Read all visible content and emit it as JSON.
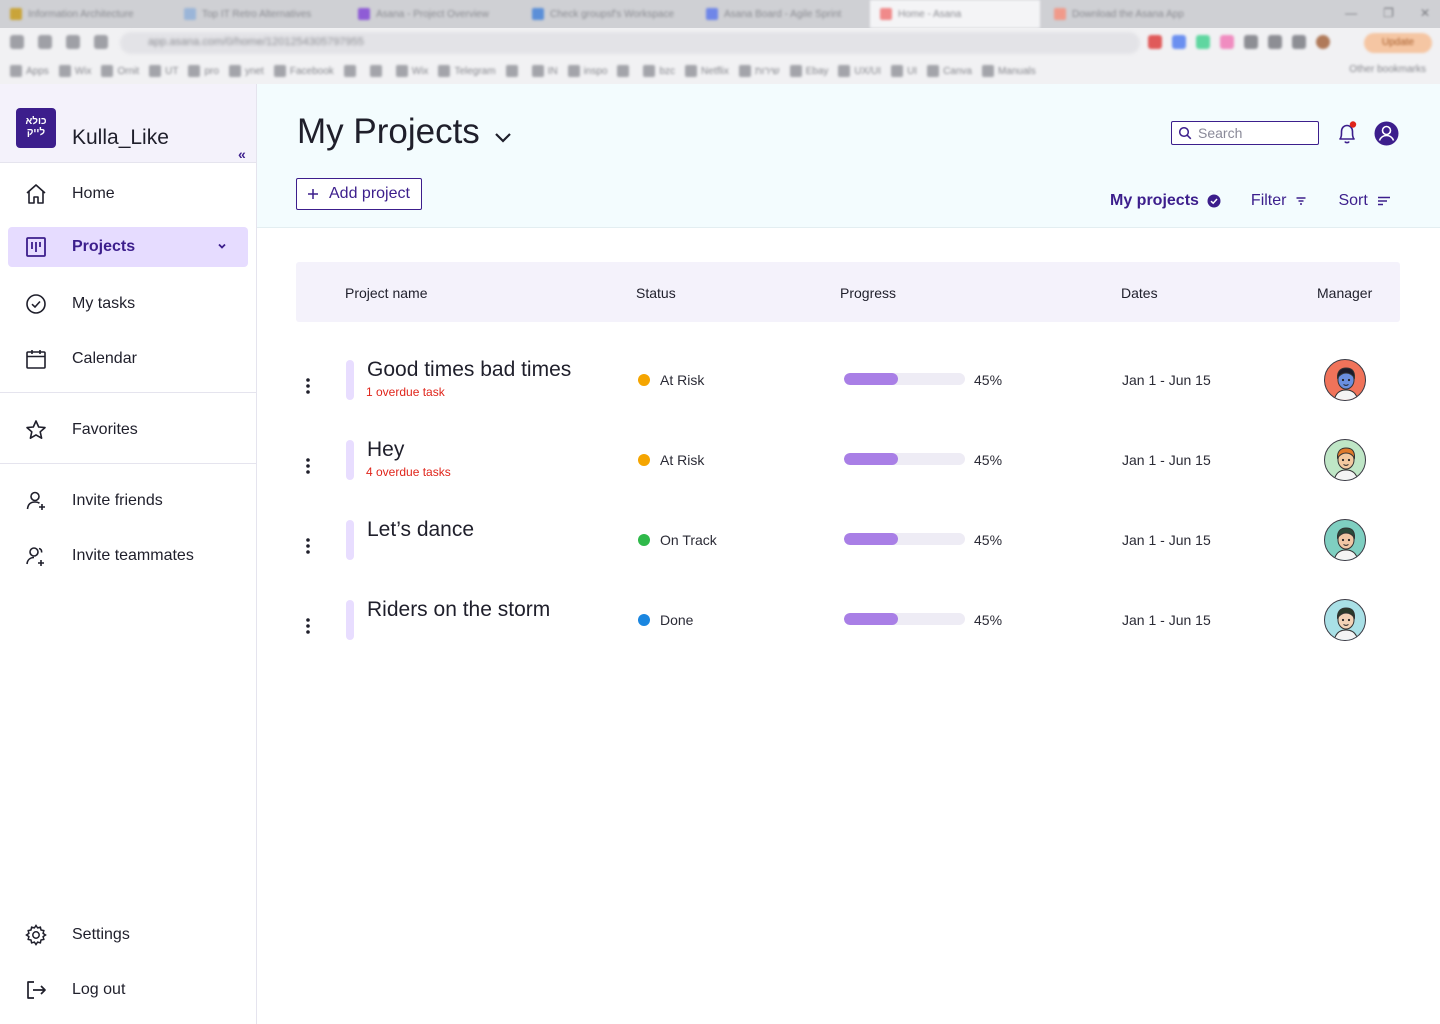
{
  "browser": {
    "tabs": [
      {
        "label": "Information Architecture",
        "favicon_color": "#c9a43a"
      },
      {
        "label": "Top IT Retro Alternatives",
        "favicon_color": "#9bb5d8"
      },
      {
        "label": "Asana - Project Overview",
        "favicon_color": "#8f5cd6"
      },
      {
        "label": "Check groupsf's Workspace",
        "favicon_color": "#5b8fd8"
      },
      {
        "label": "Asana Board - Agile Sprint",
        "favicon_color": "#6f86e8"
      },
      {
        "label": "Home - Asana",
        "favicon_color": "#f08a8a",
        "active": true
      },
      {
        "label": "Download the Asana App",
        "favicon_color": "#f09a8a"
      }
    ],
    "url": "app.asana.com/0/home/1201254305797955",
    "update_label": "Update",
    "bookmarks": [
      "Apps",
      "Wix",
      "Ornit",
      "UT",
      "pro",
      "ynet",
      "Facebook",
      "",
      "",
      "Wix",
      "Telegram",
      "",
      "IN",
      "inspo",
      "",
      "bzc",
      "Netflix",
      "שירות",
      "Ebay",
      "UX/UI",
      "UI",
      "Canva",
      "Manuals"
    ],
    "other_bookmarks": "Other bookmarks"
  },
  "sidebar": {
    "logo_text": "כולא לייק",
    "brand_name": "Kulla_Like",
    "collapse_glyph": "«",
    "items": [
      {
        "label": "Home",
        "icon": "home-icon"
      },
      {
        "label": "Projects",
        "icon": "projects-icon",
        "active": true
      },
      {
        "label": "My tasks",
        "icon": "check-circle-icon"
      },
      {
        "label": "Calendar",
        "icon": "calendar-icon"
      },
      {
        "label": "Favorites",
        "icon": "star-icon"
      },
      {
        "label": "Invite friends",
        "icon": "user-add-icon"
      },
      {
        "label": "Invite teammates",
        "icon": "team-add-icon"
      },
      {
        "label": "Settings",
        "icon": "gear-icon"
      },
      {
        "label": "Log out",
        "icon": "logout-icon"
      }
    ]
  },
  "header": {
    "title": "My Projects",
    "search_placeholder": "Search",
    "add_project_label": "Add project",
    "view": {
      "my_projects_label": "My projects",
      "filter_label": "Filter",
      "sort_label": "Sort"
    }
  },
  "table": {
    "columns": [
      "Project name",
      "Status",
      "Progress",
      "Dates",
      "Manager"
    ],
    "rows": [
      {
        "name": "Good times bad times",
        "overdue": "1 overdue task",
        "status": "At Risk",
        "status_color": "#f5a500",
        "progress": 0.45,
        "progress_label": "45%",
        "dates": "Jan 1 - Jun 15",
        "avatar_bg": "#f0735a"
      },
      {
        "name": "Hey",
        "overdue": "4 overdue tasks",
        "status": "At Risk",
        "status_color": "#f5a500",
        "progress": 0.45,
        "progress_label": "45%",
        "dates": "Jan 1 - Jun 15",
        "avatar_bg": "#bfe6c6"
      },
      {
        "name": "Let’s dance",
        "overdue": "",
        "status": "On Track",
        "status_color": "#2fb94a",
        "progress": 0.45,
        "progress_label": "45%",
        "dates": "Jan 1 - Jun 15",
        "avatar_bg": "#7fcfc1"
      },
      {
        "name": "Riders on the storm",
        "overdue": "",
        "status": "Done",
        "status_color": "#1a86e0",
        "progress": 0.45,
        "progress_label": "45%",
        "dates": "Jan 1 - Jun 15",
        "avatar_bg": "#a9e0e6"
      }
    ]
  },
  "colors": {
    "accent": "#3c1e8c",
    "active_nav_bg": "#e6dcff",
    "progress_fill": "#a97fe6",
    "overdue": "#e0251b"
  }
}
